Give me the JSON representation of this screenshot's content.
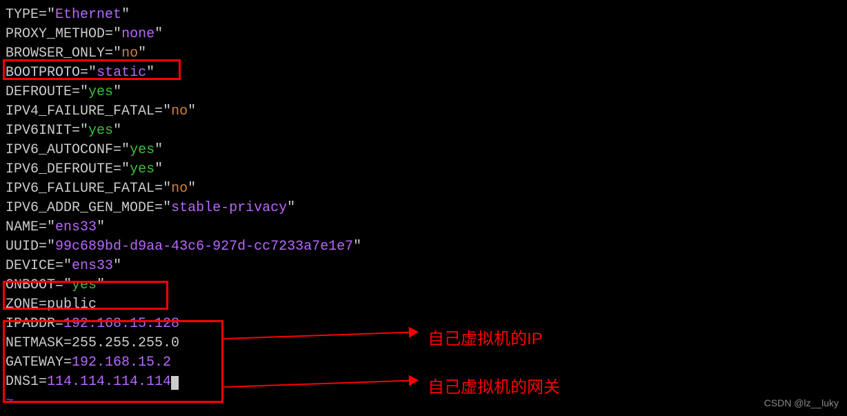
{
  "config": {
    "lines": [
      {
        "key": "TYPE",
        "value": "Ethernet",
        "quoted": true,
        "color": "purple"
      },
      {
        "key": "PROXY_METHOD",
        "value": "none",
        "quoted": true,
        "color": "purple"
      },
      {
        "key": "BROWSER_ONLY",
        "value": "no",
        "quoted": true,
        "color": "orange"
      },
      {
        "key": "BOOTPROTO",
        "value": "static",
        "quoted": true,
        "color": "purple"
      },
      {
        "key": "DEFROUTE",
        "value": "yes",
        "quoted": true,
        "color": "green"
      },
      {
        "key": "IPV4_FAILURE_FATAL",
        "value": "no",
        "quoted": true,
        "color": "orange"
      },
      {
        "key": "IPV6INIT",
        "value": "yes",
        "quoted": true,
        "color": "green"
      },
      {
        "key": "IPV6_AUTOCONF",
        "value": "yes",
        "quoted": true,
        "color": "green"
      },
      {
        "key": "IPV6_DEFROUTE",
        "value": "yes",
        "quoted": true,
        "color": "green"
      },
      {
        "key": "IPV6_FAILURE_FATAL",
        "value": "no",
        "quoted": true,
        "color": "orange"
      },
      {
        "key": "IPV6_ADDR_GEN_MODE",
        "value": "stable-privacy",
        "quoted": true,
        "color": "purple"
      },
      {
        "key": "NAME",
        "value": "ens33",
        "quoted": true,
        "color": "purple"
      },
      {
        "key": "UUID",
        "value": "99c689bd-d9aa-43c6-927d-cc7233a7e1e7",
        "quoted": true,
        "color": "purple"
      },
      {
        "key": "DEVICE",
        "value": "ens33",
        "quoted": true,
        "color": "purple"
      },
      {
        "key": "ONBOOT",
        "value": "yes",
        "quoted": true,
        "color": "green"
      },
      {
        "key": "ZONE",
        "value": "public",
        "quoted": false,
        "color": "white"
      },
      {
        "key": "IPADDR",
        "value": "192.168.15.128",
        "quoted": false,
        "color": "purple"
      },
      {
        "key": "NETMASK",
        "value": "255.255.255.0",
        "quoted": false,
        "color": "white"
      },
      {
        "key": "GATEWAY",
        "value": "192.168.15.2",
        "quoted": false,
        "color": "purple"
      },
      {
        "key": "DNS1",
        "value": "114.114.114.114",
        "quoted": false,
        "color": "purple",
        "cursor": true
      }
    ]
  },
  "annotations": {
    "ip_label": "自己虚拟机的IP",
    "gateway_label": "自己虚拟机的网关"
  },
  "watermark": "CSDN @lz__luky",
  "tilde": "~"
}
